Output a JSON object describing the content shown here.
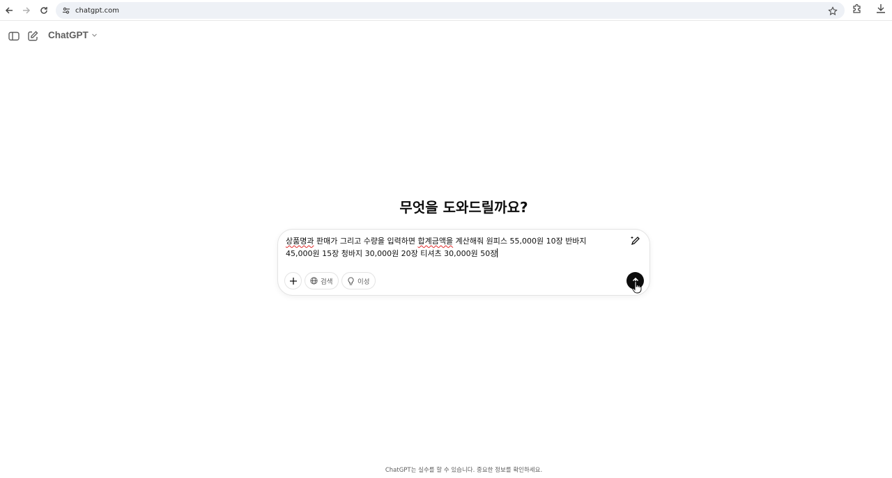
{
  "browser": {
    "url": "chatgpt.com",
    "back_icon": "arrow-left-icon",
    "forward_icon": "arrow-right-icon",
    "reload_icon": "reload-icon",
    "site_info_icon": "tune-icon",
    "bookmark_icon": "star-icon",
    "extensions_icon": "puzzle-icon",
    "download_icon": "download-icon"
  },
  "header": {
    "sidebar_icon": "sidebar-toggle-icon",
    "new_chat_icon": "new-chat-icon",
    "model_label": "ChatGPT"
  },
  "main": {
    "title": "무엇을 도와드릴까요?"
  },
  "composer": {
    "text_line1_a": "상품명과",
    "text_line1_b": " 판매가 그리고 수량을 입력하면 ",
    "text_line1_c": "합계금액을",
    "text_line1_d": " 계산해줘 원피스 55,000원 10장 반바지",
    "text_line2": "45,000원 15장 청바지 30,000원 20장 티셔츠 30,000원 50장",
    "search_label": "검색",
    "reason_label": "이성",
    "accent": "#0d0d0d"
  },
  "footer": {
    "note": "ChatGPT는 실수를 할 수 있습니다. 중요한 정보를 확인하세요."
  }
}
